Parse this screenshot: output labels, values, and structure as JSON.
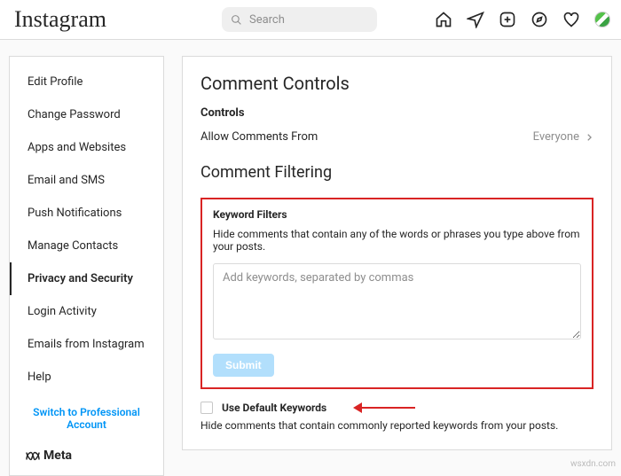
{
  "topbar": {
    "logo": "Instagram",
    "search_placeholder": "Search"
  },
  "sidebar": {
    "items": [
      {
        "label": "Edit Profile"
      },
      {
        "label": "Change Password"
      },
      {
        "label": "Apps and Websites"
      },
      {
        "label": "Email and SMS"
      },
      {
        "label": "Push Notifications"
      },
      {
        "label": "Manage Contacts"
      },
      {
        "label": "Privacy and Security"
      },
      {
        "label": "Login Activity"
      },
      {
        "label": "Emails from Instagram"
      },
      {
        "label": "Help"
      }
    ],
    "active_index": 6,
    "switch_pro": "Switch to Professional Account",
    "meta": "Meta"
  },
  "content": {
    "title1": "Comment Controls",
    "controls_label": "Controls",
    "allow_label": "Allow Comments From",
    "allow_value": "Everyone",
    "title2": "Comment Filtering",
    "keyword_filters": {
      "heading": "Keyword Filters",
      "description": "Hide comments that contain any of the words or phrases you type above from your posts.",
      "placeholder": "Add keywords, separated by commas",
      "submit": "Submit"
    },
    "default_keywords": {
      "label": "Use Default Keywords",
      "checked": false,
      "description": "Hide comments that contain commonly reported keywords from your posts."
    }
  },
  "watermark": "wsxdn.com"
}
